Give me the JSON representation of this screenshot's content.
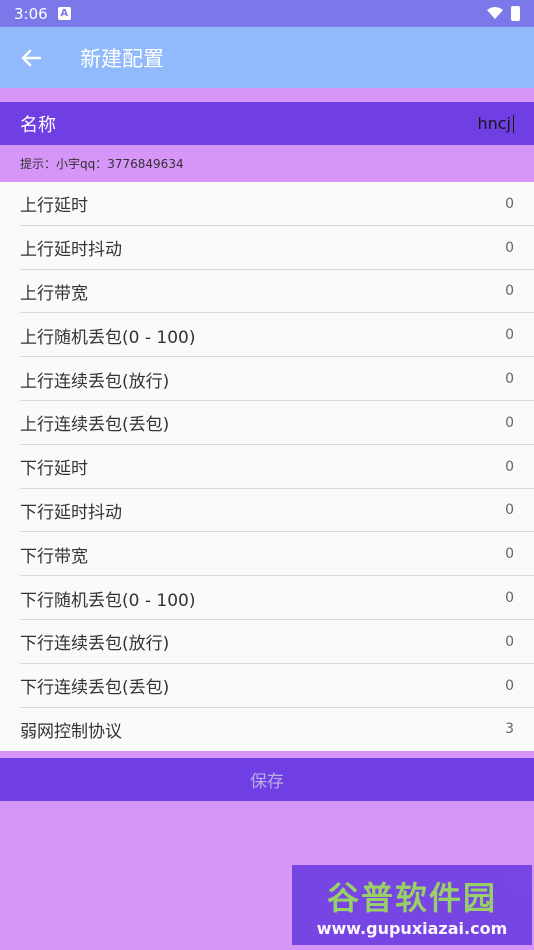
{
  "status_bar": {
    "time": "3:06",
    "notification_icon": "a-icon",
    "wifi_icon": "wifi-icon",
    "battery_icon": "battery-icon"
  },
  "appbar": {
    "title": "新建配置",
    "back_icon": "arrow-left-icon"
  },
  "name_field": {
    "label": "名称",
    "value": "hncj"
  },
  "hint": "提示：小宇qq：3776849634",
  "settings": [
    {
      "label": "上行延时",
      "value": "0"
    },
    {
      "label": "上行延时抖动",
      "value": "0"
    },
    {
      "label": "上行带宽",
      "value": "0"
    },
    {
      "label": "上行随机丢包(0 - 100)",
      "value": "0"
    },
    {
      "label": "上行连续丢包(放行)",
      "value": "0"
    },
    {
      "label": "上行连续丢包(丢包)",
      "value": "0"
    },
    {
      "label": "下行延时",
      "value": "0"
    },
    {
      "label": "下行延时抖动",
      "value": "0"
    },
    {
      "label": "下行带宽",
      "value": "0"
    },
    {
      "label": "下行随机丢包(0 - 100)",
      "value": "0"
    },
    {
      "label": "下行连续丢包(放行)",
      "value": "0"
    },
    {
      "label": "下行连续丢包(丢包)",
      "value": "0"
    },
    {
      "label": "弱网控制协议",
      "value": "3"
    }
  ],
  "save_label": "保存",
  "watermark": {
    "brand": "谷普软件园",
    "url": "www.gupuxiazai.com"
  },
  "colors": {
    "appbar": "#90bafb",
    "status_bar": "#7b79ea",
    "accent": "#6f3fe3",
    "background": "#d696f7"
  }
}
